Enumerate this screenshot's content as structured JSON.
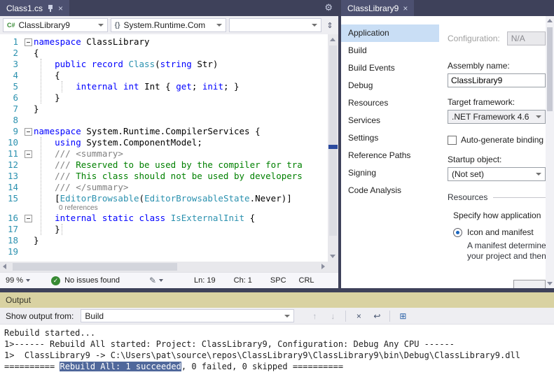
{
  "icons": {
    "close": "×",
    "gear": "⚙",
    "csharp": "C#",
    "namespace": "{}",
    "split": "⇕",
    "check": "✓",
    "pen": "✎"
  },
  "left": {
    "tab": {
      "title": "Class1.cs"
    },
    "nav": {
      "project": "ClassLibrary9",
      "type": "System.Runtime.Com",
      "member": ""
    },
    "editor": {
      "lines": [
        {
          "n": "1",
          "f": true,
          "s": [
            [
              "kw",
              "namespace"
            ],
            [
              "pl",
              " ClassLibrary"
            ]
          ]
        },
        {
          "n": "2",
          "s": [
            [
              "pl",
              "{"
            ]
          ]
        },
        {
          "n": "3",
          "s": [
            [
              "pl",
              "    "
            ],
            [
              "kw",
              "public"
            ],
            [
              "pl",
              " "
            ],
            [
              "kw",
              "record"
            ],
            [
              "pl",
              " "
            ],
            [
              "ty",
              "Class"
            ],
            [
              "pl",
              "("
            ],
            [
              "kw",
              "string"
            ],
            [
              "pl",
              " Str)"
            ]
          ]
        },
        {
          "n": "4",
          "s": [
            [
              "pl",
              "    {"
            ]
          ]
        },
        {
          "n": "5",
          "s": [
            [
              "pl",
              "        "
            ],
            [
              "kw",
              "internal"
            ],
            [
              "pl",
              " "
            ],
            [
              "kw",
              "int"
            ],
            [
              "pl",
              " Int { "
            ],
            [
              "kw",
              "get"
            ],
            [
              "pl",
              "; "
            ],
            [
              "kw",
              "init"
            ],
            [
              "pl",
              "; }"
            ]
          ]
        },
        {
          "n": "6",
          "s": [
            [
              "pl",
              "    }"
            ]
          ]
        },
        {
          "n": "7",
          "s": [
            [
              "pl",
              "}"
            ]
          ]
        },
        {
          "n": "8",
          "s": []
        },
        {
          "n": "9",
          "f": true,
          "s": [
            [
              "kw",
              "namespace"
            ],
            [
              "pl",
              " System.Runtime.CompilerServices {"
            ]
          ]
        },
        {
          "n": "10",
          "s": [
            [
              "pl",
              "    "
            ],
            [
              "kw",
              "using"
            ],
            [
              "pl",
              " System.ComponentModel;"
            ]
          ]
        },
        {
          "n": "11",
          "f": true,
          "s": [
            [
              "cg",
              "    /// <summary>"
            ]
          ]
        },
        {
          "n": "12",
          "s": [
            [
              "cg",
              "    /// "
            ],
            [
              "cm",
              "Reserved to be used by the compiler for tra"
            ]
          ]
        },
        {
          "n": "13",
          "s": [
            [
              "cg",
              "    /// "
            ],
            [
              "cm",
              "This class should not be used by developers"
            ]
          ]
        },
        {
          "n": "14",
          "s": [
            [
              "cg",
              "    /// </summary>"
            ]
          ]
        },
        {
          "n": "15",
          "s": [
            [
              "pl",
              "    ["
            ],
            [
              "ty",
              "EditorBrowsable"
            ],
            [
              "pl",
              "("
            ],
            [
              "ty",
              "EditorBrowsableState"
            ],
            [
              "pl",
              ".Never)]"
            ]
          ]
        },
        {
          "n": "16",
          "f": true,
          "lens": "0 references",
          "s": [
            [
              "pl",
              "    "
            ],
            [
              "kw",
              "internal"
            ],
            [
              "pl",
              " "
            ],
            [
              "kw",
              "static"
            ],
            [
              "pl",
              " "
            ],
            [
              "kw",
              "class"
            ],
            [
              "pl",
              " "
            ],
            [
              "ty",
              "IsExternalInit"
            ],
            [
              "pl",
              " {"
            ]
          ]
        },
        {
          "n": "17",
          "s": [
            [
              "pl",
              "    }"
            ]
          ]
        },
        {
          "n": "18",
          "s": [
            [
              "pl",
              "}"
            ]
          ]
        },
        {
          "n": "19",
          "s": []
        }
      ]
    },
    "status": {
      "zoom": "99 %",
      "issues": "No issues found",
      "ln": "Ln: 19",
      "ch": "Ch: 1",
      "spc": "SPC",
      "eol": "CRL"
    }
  },
  "right": {
    "tab": {
      "title": "ClassLibrary9"
    },
    "sidebar": {
      "items": [
        {
          "label": "Application",
          "selected": true
        },
        {
          "label": "Build"
        },
        {
          "label": "Build Events"
        },
        {
          "label": "Debug"
        },
        {
          "label": "Resources"
        },
        {
          "label": "Services"
        },
        {
          "label": "Settings"
        },
        {
          "label": "Reference Paths"
        },
        {
          "label": "Signing"
        },
        {
          "label": "Code Analysis"
        }
      ]
    },
    "form": {
      "configuration_label": "Configuration:",
      "configuration_value": "N/A",
      "assembly_label": "Assembly name:",
      "assembly_value": "ClassLibrary9",
      "target_label": "Target framework:",
      "target_value": ".NET Framework 4.6",
      "autogen_label": "Auto-generate binding",
      "startup_label": "Startup object:",
      "startup_value": "(Not set)",
      "resources_header": "Resources",
      "resources_desc": "Specify how application",
      "radio_label": "Icon and manifest",
      "radio_desc1": "A manifest determine",
      "radio_desc2": "your project and then"
    }
  },
  "output": {
    "title": "Output",
    "show_from_label": "Show output from:",
    "source": "Build",
    "toolbar_icons": [
      {
        "name": "prev-message-icon",
        "glyph": "↑",
        "state": "disabled"
      },
      {
        "name": "next-message-icon",
        "glyph": "↓",
        "state": "disabled",
        "sep_after": true
      },
      {
        "name": "clear-all-icon",
        "glyph": "×",
        "state": "normal"
      },
      {
        "name": "word-wrap-icon",
        "glyph": "↩",
        "state": "normal",
        "sep_after": true
      },
      {
        "name": "messages-grid-icon",
        "glyph": "⊞",
        "state": "accent"
      }
    ],
    "lines": [
      [
        [
          "pl",
          "Rebuild started..."
        ]
      ],
      [
        [
          "pl",
          "1>------ Rebuild All started: Project: ClassLibrary9, Configuration: Debug Any CPU ------"
        ]
      ],
      [
        [
          "pl",
          "1>  ClassLibrary9 -> C:\\Users\\pat\\source\\repos\\ClassLibrary9\\ClassLibrary9\\bin\\Debug\\ClassLibrary9.dll"
        ]
      ],
      [
        [
          "pl",
          "========== "
        ],
        [
          "hl",
          "Rebuild All: 1 succeeded"
        ],
        [
          "pl",
          ", 0 failed, 0 skipped =========="
        ]
      ]
    ]
  }
}
